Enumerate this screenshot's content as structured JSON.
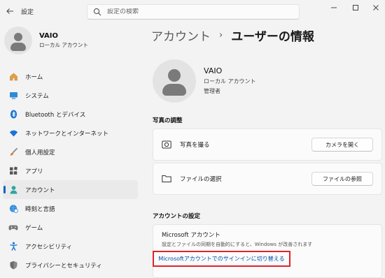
{
  "app": {
    "title": "設定"
  },
  "search": {
    "placeholder": "設定の検索"
  },
  "profile": {
    "name": "VAIO",
    "subtitle": "ローカル アカウント"
  },
  "sidebar": {
    "items": [
      {
        "label": "ホーム",
        "icon": "home-icon"
      },
      {
        "label": "システム",
        "icon": "monitor-icon"
      },
      {
        "label": "Bluetooth とデバイス",
        "icon": "bluetooth-icon"
      },
      {
        "label": "ネットワークとインターネット",
        "icon": "wifi-icon"
      },
      {
        "label": "個人用設定",
        "icon": "brush-icon"
      },
      {
        "label": "アプリ",
        "icon": "apps-icon"
      },
      {
        "label": "アカウント",
        "icon": "person-icon",
        "active": true
      },
      {
        "label": "時刻と言語",
        "icon": "globe-clock-icon"
      },
      {
        "label": "ゲーム",
        "icon": "gamepad-icon"
      },
      {
        "label": "アクセシビリティ",
        "icon": "accessibility-icon"
      },
      {
        "label": "プライバシーとセキュリティ",
        "icon": "shield-icon"
      }
    ]
  },
  "breadcrumb": {
    "parent": "アカウント",
    "separator": "›",
    "current": "ユーザーの情報"
  },
  "user": {
    "name": "VAIO",
    "account_type": "ローカル アカウント",
    "role": "管理者"
  },
  "photo_section": {
    "title": "写真の調整",
    "rows": [
      {
        "label": "写真を撮る",
        "icon": "camera-icon",
        "button": "カメラを開く"
      },
      {
        "label": "ファイルの選択",
        "icon": "folder-icon",
        "button": "ファイルの参照"
      }
    ]
  },
  "account_section": {
    "title": "アカウントの設定",
    "ms_title": "Microsoft アカウント",
    "ms_desc": "設定とファイルの同期を自動的にすると、Windows が改善されます",
    "ms_link": "Microsoftアカウントでのサインインに切り替える"
  },
  "colors": {
    "accent": "#0067c0",
    "highlight_border": "#e0232a",
    "link": "#0050a8"
  }
}
